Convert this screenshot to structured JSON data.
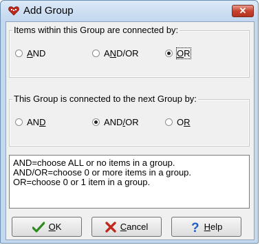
{
  "window": {
    "title": "Add Group",
    "close_icon": "close-icon"
  },
  "group_within": {
    "legend": "Items within this Group are connected by:",
    "options": [
      {
        "label": "AND",
        "mnemonic": "A",
        "selected": false
      },
      {
        "label": "AND/OR",
        "mnemonic": "N",
        "selected": false
      },
      {
        "label": "OR",
        "mnemonic": "O",
        "selected": true
      }
    ]
  },
  "group_next": {
    "legend": "This Group is connected to the next Group by:",
    "options": [
      {
        "label": "AND",
        "mnemonic": "D",
        "selected": false
      },
      {
        "label": "AND/OR",
        "mnemonic": "/",
        "selected": true
      },
      {
        "label": "OR",
        "mnemonic": "R",
        "selected": false
      }
    ]
  },
  "info_lines": [
    "AND=choose ALL or no items in a group.",
    "AND/OR=choose 0 or more items in a group.",
    "OR=choose 0 or 1 item in a group."
  ],
  "buttons": {
    "ok": "OK",
    "cancel": "Cancel",
    "help": "Help"
  },
  "colors": {
    "ok_check": "#2f8a1e",
    "cancel_x": "#c0281b",
    "help_q": "#1f5fc4",
    "close": "#c8432f"
  }
}
